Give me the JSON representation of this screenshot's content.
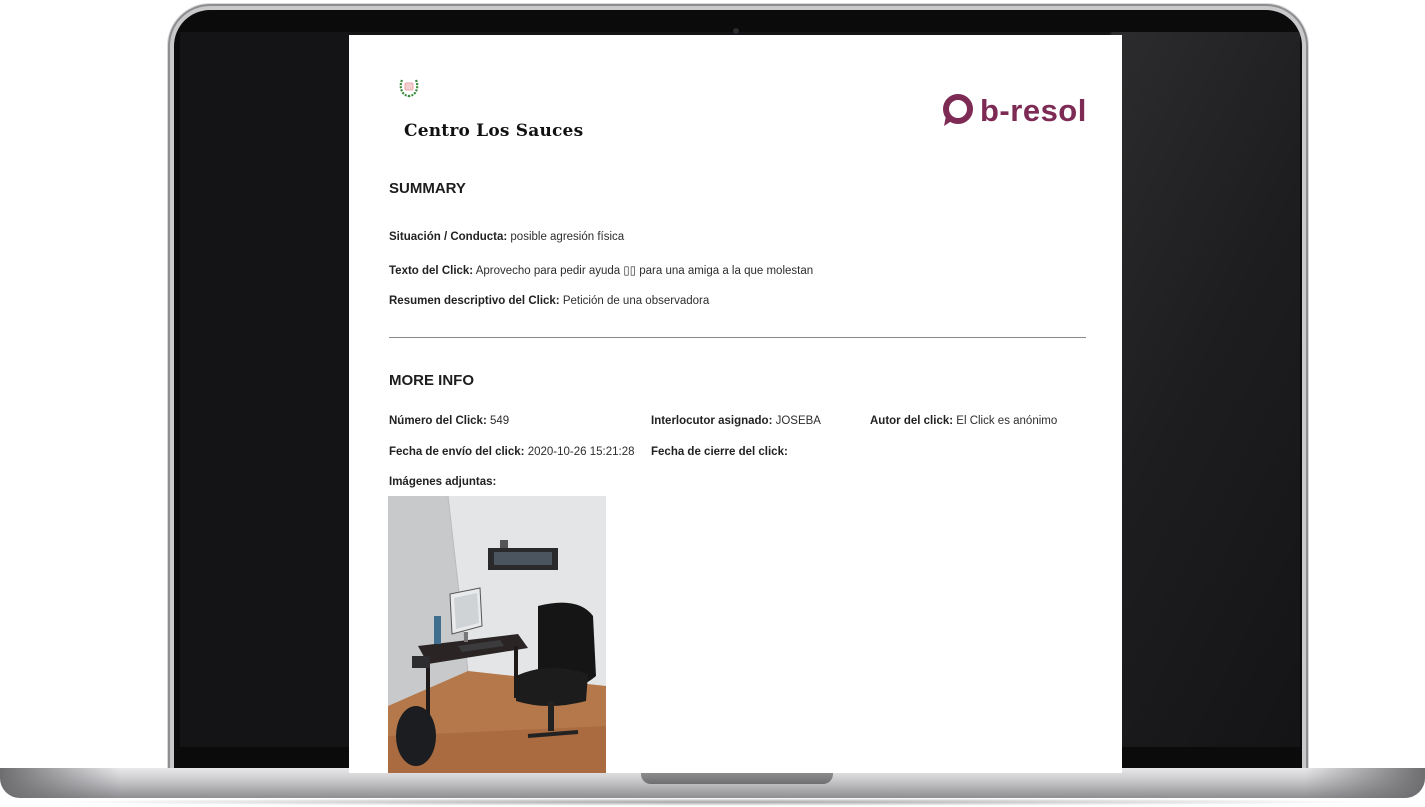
{
  "document": {
    "school_name": "Centro Los Sauces",
    "brand_name": "b-resol",
    "brand_color": "#7d2a55",
    "summary": {
      "title": "SUMMARY",
      "situation_label": "Situación / Conducta:",
      "situation_value": " posible agresión física",
      "text_label": "Texto del Click:",
      "text_value": " Aprovecho para pedir ayuda ▯▯ para una amiga a la que molestan",
      "summary_label": "Resumen descriptivo del Click:",
      "summary_value": " Petición de una observadora"
    },
    "more_info": {
      "title": "MORE INFO",
      "number_label": "Número del Click:",
      "number_value": " 549",
      "interlocutor_label": "Interlocutor asignado:",
      "interlocutor_value": " JOSEBA",
      "author_label": "Autor del click:",
      "author_value": " El Click es anónimo",
      "sent_label": "Fecha de envío del click:",
      "sent_value": " 2020-10-26 15:21:28",
      "closed_label": "Fecha de cierre del click:",
      "closed_value": "",
      "images_label": "Imágenes adjuntas:"
    }
  }
}
